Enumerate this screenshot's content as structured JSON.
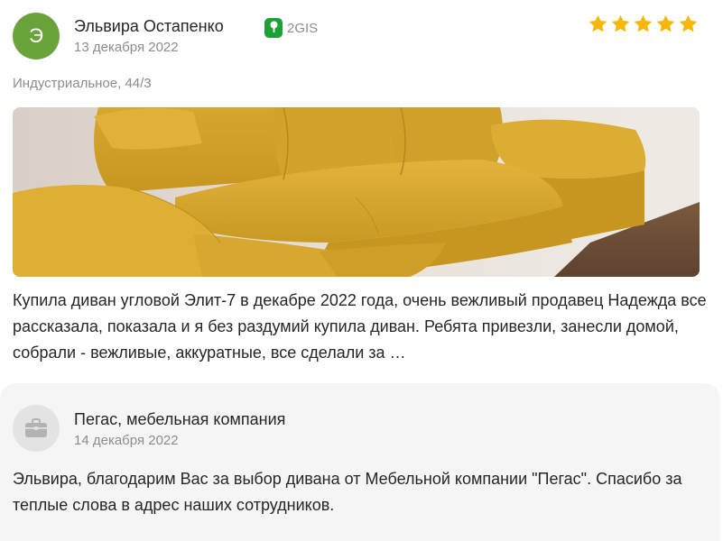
{
  "review": {
    "avatar_letter": "Э",
    "avatar_color": "#6aa33c",
    "author": "Эльвира Остапенко",
    "source_label": "2GIS",
    "source_icon": "2gis-icon",
    "source_color": "#1ba136",
    "date": "13 декабря 2022",
    "rating": 5,
    "rating_max": 5,
    "star_color": "#f5b80a",
    "address": "Индустриальное, 44/3",
    "photo": "yellow-sofa-photo",
    "text": "Купила диван угловой Элит-7 в декабре 2022 года, очень вежливый продавец Надежда все рассказала, показала и я без раздумий купила диван. Ребята привезли, занесли домой, собрали - вежливые, аккуратные, все сделали за …"
  },
  "reply": {
    "icon": "briefcase-icon",
    "company": "Пегас, мебельная компания",
    "date": "14 декабря 2022",
    "text": "Эльвира, благодарим Вас за выбор дивана от Мебельной компании \"Пегас\". Спасибо за теплые слова в адрес наших сотрудников."
  }
}
